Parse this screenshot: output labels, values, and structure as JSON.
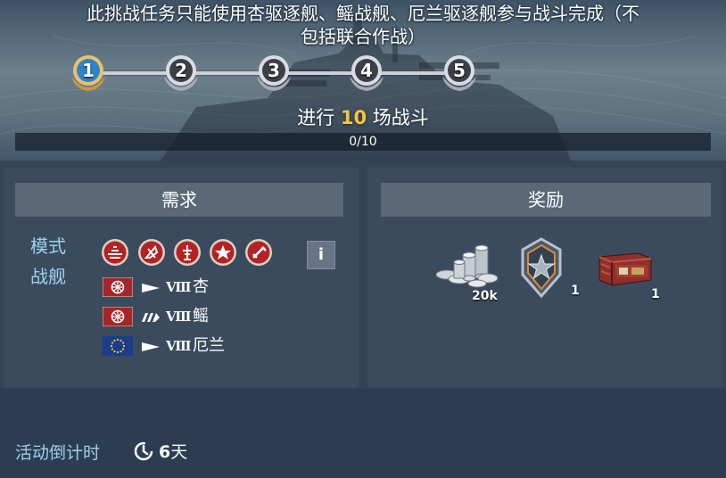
{
  "header": {
    "title": "此挑战任务只能使用杏驱逐舰、鳐战舰、厄兰驱逐舰参与战斗完成（不\n包括联合作战）",
    "stages": [
      "1",
      "2",
      "3",
      "4",
      "5"
    ],
    "active_stage": 1,
    "goal_prefix": "进行",
    "goal_count": "10",
    "goal_suffix": "场战斗",
    "progress_text": "0/10",
    "progress_fraction": 0
  },
  "requirements": {
    "heading": "需求",
    "mode_label": "模式",
    "ships_label": "战舰",
    "modes": [
      "random-battle-icon",
      "ranked-battle-icon",
      "operations-icon",
      "coop-battle-icon",
      "event-battle-icon"
    ],
    "info_label": "i",
    "ships": [
      {
        "flag": "pan-asia-flag-icon",
        "type_icon": "destroyer-icon",
        "tier": "Ⅷ",
        "nation": "杏"
      },
      {
        "flag": "pan-asia-flag-icon",
        "type_icon": "battleship-icon",
        "tier": "Ⅷ",
        "nation": "鳐"
      },
      {
        "flag": "europe-flag-icon",
        "type_icon": "destroyer-icon",
        "tier": "Ⅷ",
        "nation": "厄兰"
      }
    ]
  },
  "rewards": {
    "heading": "奖励",
    "items": [
      {
        "icon": "silver-credits-icon",
        "count": "20k"
      },
      {
        "icon": "commander-rank-badge-icon",
        "count": "1"
      },
      {
        "icon": "supply-container-icon",
        "count": "1"
      }
    ]
  },
  "footer": {
    "countdown_label": "活动倒计时",
    "countdown_value": "6",
    "countdown_unit": "天"
  },
  "colors": {
    "accent_gold": "#f7c63c",
    "label_blue": "#9ed0ea",
    "mode_red": "#b32326",
    "panel_bg": "#3a4b5e"
  }
}
